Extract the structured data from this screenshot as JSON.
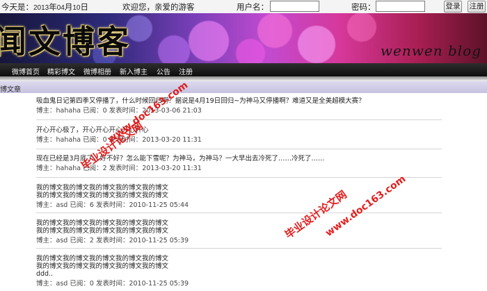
{
  "topbar": {
    "today_label": "今天是：",
    "date_year": "2013",
    "date_year_suffix": "年",
    "date_month": "04",
    "date_month_suffix": "月",
    "date_day": "10",
    "date_day_suffix": "日",
    "welcome": "欢迎您，亲爱的游客",
    "username_label": "用户名：",
    "username_value": "",
    "password_label": "密码：",
    "password_value": "",
    "login_button": "登录",
    "register_button": "注册"
  },
  "banner": {
    "title": "闻文博客",
    "subtitle": "wenwen blog"
  },
  "nav": {
    "items": [
      "微博首页",
      "精彩博文",
      "微博相册",
      "新入博主",
      "公告",
      "注册"
    ]
  },
  "section": {
    "title": "博文章"
  },
  "posts": [
    {
      "title": "吸血鬼日记第四季又停播了，什么时候回归啊？据说是4月19日回归~为神马又停播啊？难道又是全美超模大赛？",
      "author_label": "博主：",
      "author": "hahaha",
      "reads_label": "已阅：",
      "reads": "0",
      "time_label": "发表时间：",
      "time": "2013-03-06 21:03"
    },
    {
      "title": "开心开心极了，开心开心开心开心开心",
      "author_label": "博主：",
      "author": "hahaha",
      "reads_label": "已阅：",
      "reads": "0",
      "time_label": "发表时间：",
      "time": "2013-03-20 11:31"
    },
    {
      "title": "现在已经是3月底了，好不好？怎么能下雪呢？为神马，为神马？一大早出去冷死了……冷死了……",
      "author_label": "博主：",
      "author": "hahaha",
      "reads_label": "已阅：",
      "reads": "2",
      "time_label": "发表时间：",
      "time": "2013-03-20 11:31"
    },
    {
      "title": "我的博文我的博文我的博文我的博文我的博文",
      "title2": "我的博文我的博文我的博文我的博文我的博文",
      "author_label": "博主：",
      "author": "asd",
      "reads_label": "已阅：",
      "reads": "6",
      "time_label": "发表时间：",
      "time": "2010-11-25 05:44"
    },
    {
      "title": "我的博文我的博文我的博文我的博文我的博文",
      "title2": "我的博文我的博文我的博文我的博文我的博文",
      "author_label": "博主：",
      "author": "asd",
      "reads_label": "已阅：",
      "reads": "2",
      "time_label": "发表时间：",
      "time": "2010-11-25 05:39"
    },
    {
      "title": "我的博文我的博文我的博文我的博文我的博文",
      "title2": "我的博文我的博文我的博文我的博文我的博文",
      "title3": "ddd..",
      "author_label": "博主：",
      "author": "asd",
      "reads_label": "已阅：",
      "reads": "0",
      "time_label": "发表时间：",
      "time": "2010-11-25 05:39"
    }
  ],
  "watermarks": {
    "site_url": "www.doc163.com",
    "site_name": "毕业设计论文网"
  },
  "colors": {
    "watermark": "#e01414",
    "nav_bg": "#1a1a1a",
    "section_bg": "#cdc9e4"
  }
}
